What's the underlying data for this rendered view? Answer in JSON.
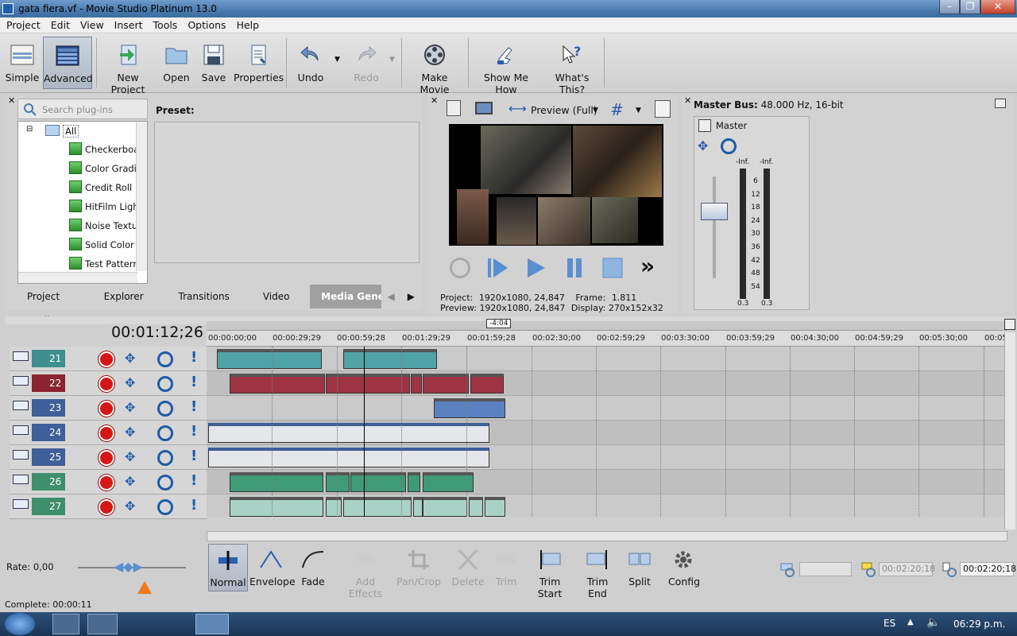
{
  "window": {
    "title": "gata fiera.vf - Movie Studio Platinum 13.0"
  },
  "menu": [
    "Project",
    "Edit",
    "View",
    "Insert",
    "Tools",
    "Options",
    "Help"
  ],
  "toolbar": {
    "simple": "Simple",
    "advanced": "Advanced",
    "new_project": "New Project",
    "open": "Open",
    "save": "Save",
    "properties": "Properties",
    "undo": "Undo",
    "redo": "Redo",
    "make_movie": "Make Movie",
    "show_me_how": "Show Me How",
    "whats_this": "What's This?"
  },
  "plugins": {
    "search_placeholder": "Search plug-ins",
    "preset_label": "Preset:",
    "tree_root": "All",
    "items": [
      "Checkerboar",
      "Color Gradier",
      "Credit Roll",
      "HitFilm Light I",
      "Noise Textur",
      "Solid Color",
      "Test Pattern"
    ]
  },
  "tabs": [
    "Project Media",
    "Explorer",
    "Transitions",
    "Video FX",
    "Media Generato"
  ],
  "preview": {
    "mode": "Preview (Full)",
    "project_label": "Project:",
    "project_value": "1920x1080, 24,847",
    "frame_label": "Frame:",
    "frame_value": "1.811",
    "preview_label": "Preview:",
    "preview_value": "1920x1080, 24,847",
    "display_label": "Display:",
    "display_value": "270x152x32"
  },
  "master": {
    "bus_label": "Master Bus:",
    "bus_value": "48.000 Hz, 16-bit",
    "name": "Master",
    "peak_left": "-Inf.",
    "peak_right": "-Inf.",
    "scale": [
      "6",
      "12",
      "18",
      "24",
      "30",
      "36",
      "42",
      "48",
      "54"
    ],
    "fader_left": "0.3",
    "fader_right": "0.3"
  },
  "timeline": {
    "timecode": "00:01:12;26",
    "loop_marker": "-4:04",
    "ruler": [
      "00:00:00;00",
      "00:00:29;29",
      "00:00:59;28",
      "00:01:29;29",
      "00:01:59;28",
      "00:02:30;00",
      "00:02:59;29",
      "00:03:30;00",
      "00:03:59;29",
      "00:04:30;00",
      "00:04:59;29",
      "00:05:30;00",
      "00:05"
    ],
    "tracks": [
      {
        "num": "21",
        "color": "#3f8f8f"
      },
      {
        "num": "22",
        "color": "#8a2430"
      },
      {
        "num": "23",
        "color": "#3e5f98"
      },
      {
        "num": "24",
        "color": "#3e5f98"
      },
      {
        "num": "25",
        "color": "#3e5f98"
      },
      {
        "num": "26",
        "color": "#3f8f6a"
      },
      {
        "num": "27",
        "color": "#3f8f6a"
      }
    ]
  },
  "edit_tools": {
    "normal": "Normal",
    "envelope": "Envelope",
    "fade": "Fade",
    "add_effects": "Add Effects",
    "pan_crop": "Pan/Crop",
    "delete": "Delete",
    "trim": "Trim",
    "trim_start": "Trim Start",
    "trim_end": "Trim End",
    "split": "Split",
    "config": "Config"
  },
  "status": {
    "rate": "Rate: 0,00",
    "complete": "Complete: 00:00:11",
    "sel_start": "00:02:20;18",
    "sel_length": "00:02:20;18"
  },
  "taskbar": {
    "lang": "ES",
    "time": "06:29 p.m."
  }
}
